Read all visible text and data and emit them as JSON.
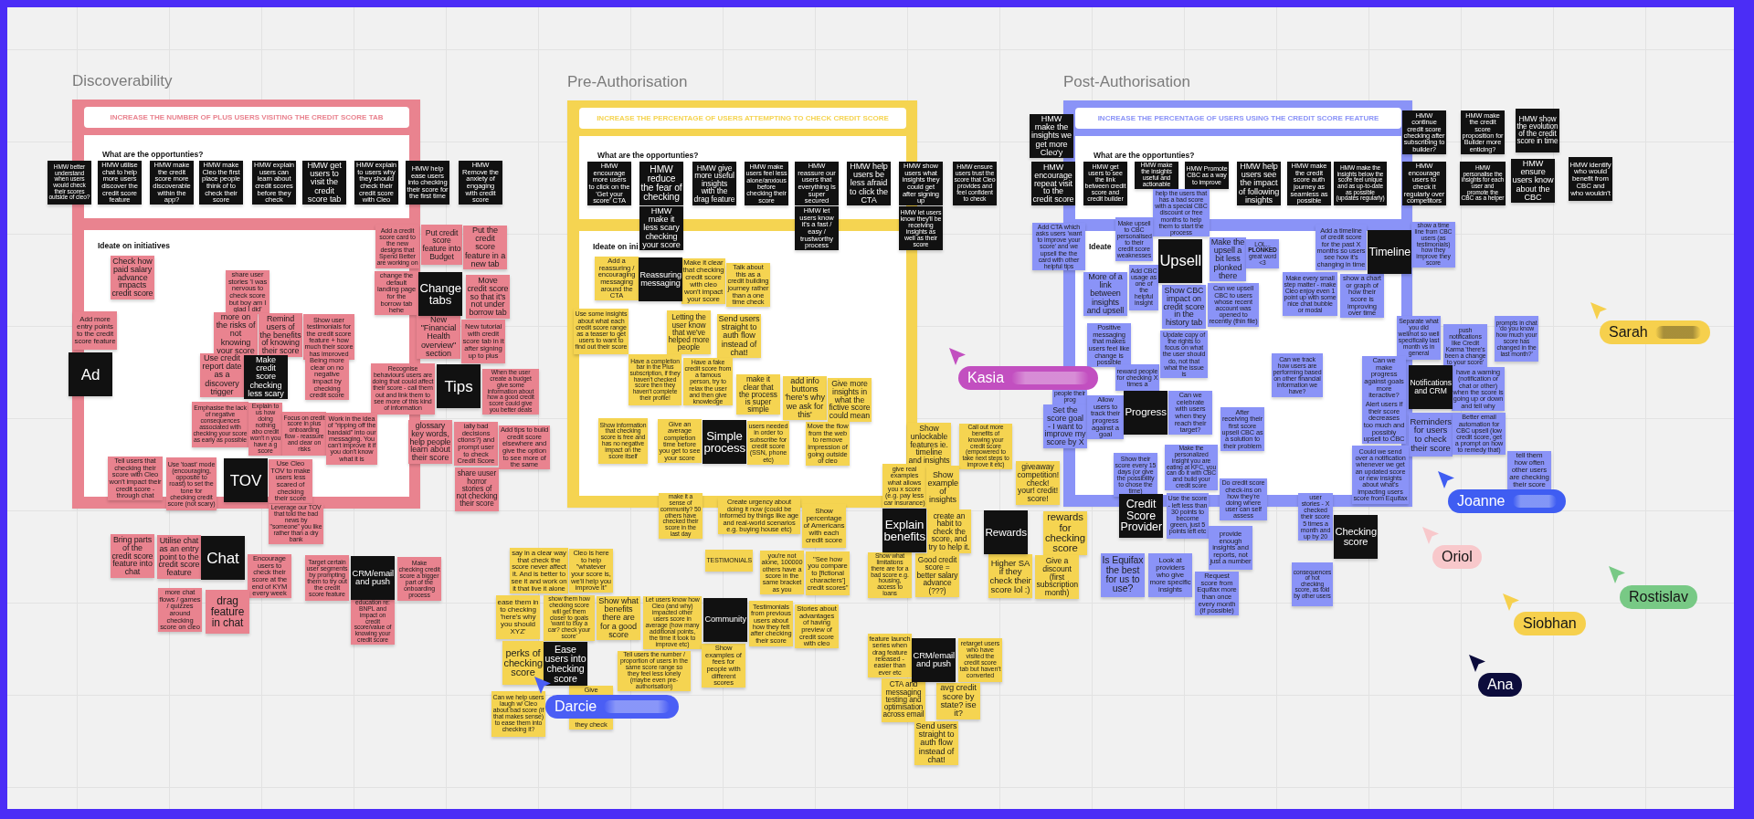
{
  "boards": [
    {
      "title": "Discoverability",
      "color": "#e9838f",
      "goal": "INCREASE THE NUMBER OF PLUS USERS VISITING THE CREDIT SCORE TAB",
      "opportunities_heading": "What are the opportunties?",
      "ideate_heading": "Ideate on initiatives",
      "opportunities": [
        "HMW better understand when users would check their scores outside of cleo?",
        "HMW utilise chat to help more users discover the credit score feature",
        "HMW make the credit score more discoverable within the app?",
        "HMW make Cleo the first place people think of to check their score",
        "HMW explain users can learn about credit scores before they check",
        "HMW get users to visit the credit score tab",
        "HMW explain to users why they should check their credit score with Cleo",
        "HMW help ease users into checking their score for the first time",
        "HMW Remove the anxiety of engaging with credit score"
      ],
      "notes": [
        {
          "kind": "idea",
          "text": "Add a credit score card to the new designs that Spend Better are working on"
        },
        {
          "kind": "idea",
          "text": "Put credit score feature into Budget"
        },
        {
          "kind": "idea",
          "text": "Put the credit score feature in a new tab"
        },
        {
          "kind": "idea",
          "text": "Check how paid salary advance impacts credit score"
        },
        {
          "kind": "idea",
          "text": "share user stories 'I was nervous to check score but boy am I glad I did'"
        },
        {
          "kind": "idea",
          "text": "change the default landing page for the borrow tab hehe"
        },
        {
          "kind": "theme",
          "text": "Change tabs"
        },
        {
          "kind": "idea",
          "text": "Move credit score so that it's not under borrow tab"
        },
        {
          "kind": "idea",
          "text": "Add more entry points to the credit score feature"
        },
        {
          "kind": "idea",
          "text": "more on the risks of not knowing your score"
        },
        {
          "kind": "idea",
          "text": "Remind users of the benefits of knowing their score"
        },
        {
          "kind": "idea",
          "text": "Show user testimonials for the credit score feature + how much their score has improved"
        },
        {
          "kind": "idea",
          "text": "New \"Financial Health overview\" section"
        },
        {
          "kind": "idea",
          "text": "New tutorial with credit score tab in it after signing up to plus"
        },
        {
          "kind": "theme",
          "text": "Ad"
        },
        {
          "kind": "idea",
          "text": "Use credit report date as a discovery trigger"
        },
        {
          "kind": "theme",
          "text": "Make credit score checking less scary"
        },
        {
          "kind": "idea",
          "text": "Being more clear on no negative impact by checking credit score"
        },
        {
          "kind": "idea",
          "text": "Recognise behaviours users are doing that could affect their score - call them out and link them to see more of this kind of information"
        },
        {
          "kind": "theme",
          "text": "Tips"
        },
        {
          "kind": "idea",
          "text": "When the user create a budget give some information about how a good credit score could give you better deals"
        },
        {
          "kind": "idea",
          "text": "Emphasise the lack of negative consequences associated with checking your score as early as possible"
        },
        {
          "kind": "idea",
          "text": "Explain to us how doing nothing abo credit won't n you have a g score"
        },
        {
          "kind": "idea",
          "text": "Focus on credit score in plus onboarding flow - reassure and clear on risks"
        },
        {
          "kind": "idea",
          "text": "Work in the idea of \"ripping off the bandaid\" into our messaging. You can't improve it if you don't know what it is"
        },
        {
          "kind": "idea",
          "text": "glossary key words, help people learn about their score"
        },
        {
          "kind": "idea",
          "text": "ially bad decisions ctions?) and prompt user to check Credit Score"
        },
        {
          "kind": "idea",
          "text": "Add tips to build credit score elsewhere and give the option to see more of the same"
        },
        {
          "kind": "idea",
          "text": "Tell users that checking their score with Cleo won't impact their credit score - through chat"
        },
        {
          "kind": "idea",
          "text": "Use 'toast' mode (encouraging, opposite to roast) to set the tone for checking credit score (not scary)"
        },
        {
          "kind": "theme",
          "text": "TOV"
        },
        {
          "kind": "idea",
          "text": "Use Cleo TOV to make users less scared of checking their score"
        },
        {
          "kind": "idea",
          "text": "share uuser horror stories of not checking their score"
        },
        {
          "kind": "idea",
          "text": "Leverage our TOV that told the bad news by \"someone\" you like rather than a dry bank"
        },
        {
          "kind": "idea",
          "text": "Bring parts of the credit score feature into chat"
        },
        {
          "kind": "idea",
          "text": "Utilise chat as an entry point to the credit score feature"
        },
        {
          "kind": "theme",
          "text": "Chat"
        },
        {
          "kind": "idea",
          "text": "Encourage users to check their score at the end of KYM every week"
        },
        {
          "kind": "idea",
          "text": "Target certain user segments by prompting them to try out the credit score feature"
        },
        {
          "kind": "theme",
          "text": "CRM/email and push"
        },
        {
          "kind": "idea",
          "text": "Make checking credit score a bigger part of the onboarding process"
        },
        {
          "kind": "idea",
          "text": "more chat flows / games / quizzes around checking score on cleo"
        },
        {
          "kind": "idea",
          "text": "drag feature in chat"
        },
        {
          "kind": "idea",
          "text": "education re: BNPL and impact on credit score/value of knowing your credit score"
        }
      ]
    },
    {
      "title": "Pre-Authorisation",
      "color": "#f5d451",
      "goal": "INCREASE THE PERCENTAGE OF USERS ATTEMPTING TO CHECK CREDIT SCORE",
      "opportunities_heading": "What are the opportunties?",
      "ideate_heading": "Ideate on ini",
      "opportunities": [
        "HMW encourage more users to click on the 'Get your score' CTA",
        "HMW reduce the fear of checking",
        "HMW give more useful insights with the drag feature",
        "HMW make users feel less alone/anxious before checking their score",
        "HMW reassure our users that everything is super secured",
        "HMW help users be less afraid to click the CTA",
        "HMW show users what insights they could get after signing up",
        "HMW ensure users trust the score that Cleo provides and feel confident to check",
        "HMW make it less scary checking your score",
        "HMW let users know it's a fast / easy / trustworthy process",
        "HMW let users know they'll be receiving insights as well as their score"
      ],
      "notes": [
        {
          "kind": "idea",
          "text": "Add a reassuring / encouraging messaging around the CTA"
        },
        {
          "kind": "theme",
          "text": "Reassuring messaging"
        },
        {
          "kind": "idea",
          "text": "Make it clear that checking credit score with cleo won't impact your score"
        },
        {
          "kind": "idea",
          "text": "Talk about this as a credit building journey rather than a one time check"
        },
        {
          "kind": "idea",
          "text": "Use some insights about what each credit score range as a teaser to get users to want to find out their score"
        },
        {
          "kind": "idea",
          "text": "Letting the user know that we've helped more people"
        },
        {
          "kind": "idea",
          "text": "Send users straight to auth flow instead of chat!"
        },
        {
          "kind": "idea",
          "text": "Have a completion bar in the Plus subscription, if they haven't checked score then they haven't complete their profile!"
        },
        {
          "kind": "idea",
          "text": "Have a fake credit score from a famous person, try to relax the user and then give knowledge"
        },
        {
          "kind": "idea",
          "text": "make it clear that the process is super simple"
        },
        {
          "kind": "idea",
          "text": "add info buttons 'here's why we ask for this'"
        },
        {
          "kind": "idea",
          "text": "Give more insights in what the fictive score could mean"
        },
        {
          "kind": "idea",
          "text": "Show information that checking score is free and has no negative impact on the score itself"
        },
        {
          "kind": "idea",
          "text": "Give an average completion time before you get to see your score"
        },
        {
          "kind": "theme",
          "text": "Simple process"
        },
        {
          "kind": "idea",
          "text": "users needed in order to subscribe for credit score (SSN, phone etc)"
        },
        {
          "kind": "idea",
          "text": "Move the flow from the web to remove impression of going outside of cleo"
        },
        {
          "kind": "idea",
          "text": "Show unlockable features ie. timeline and insights"
        },
        {
          "kind": "idea",
          "text": "Call out more benefits of knowing your credit score (empowered to take next steps to improve it etc)"
        },
        {
          "kind": "idea",
          "text": "give real examples what allows you x score (e.g. pay less car insurance)"
        },
        {
          "kind": "idea",
          "text": "Show example of insights"
        },
        {
          "kind": "idea",
          "text": "giveaway competition! check! your! credit! score!"
        },
        {
          "kind": "idea",
          "text": "make it a sense of community? 50 others have checked their score in the last day"
        },
        {
          "kind": "idea",
          "text": "Create urgency about doing it now (could be informed by things like age and real-world scenarios e.g. buying house etc)"
        },
        {
          "kind": "idea",
          "text": "Show percentage of Americans with each credit score"
        },
        {
          "kind": "theme",
          "text": "Explain benefits"
        },
        {
          "kind": "idea",
          "text": "create an habit to check the score, and try to help it."
        },
        {
          "kind": "theme",
          "text": "Rewards"
        },
        {
          "kind": "idea",
          "text": "rewards for checking score"
        },
        {
          "kind": "idea",
          "text": "say in a clear way that check the score never affect it. And is better to see it and work on it that live it alone"
        },
        {
          "kind": "idea",
          "text": "Cleo is here to help \"whatever your score is, we'll help you improve it\""
        },
        {
          "kind": "idea",
          "text": "TESTIMONIALS"
        },
        {
          "kind": "idea",
          "text": "you're not alone, 100000 others have a score in the same bracket as you"
        },
        {
          "kind": "idea",
          "text": "\"See how you compare to [fictional characters'] credit scores\""
        },
        {
          "kind": "idea",
          "text": "Show what limitations there are for a bad score e.g. housing, access to loans"
        },
        {
          "kind": "idea",
          "text": "Good credit score = better salary advance (???)"
        },
        {
          "kind": "idea",
          "text": "Higher SA if they check their score lol :)"
        },
        {
          "kind": "idea",
          "text": "Give a discount (first subscription month)"
        },
        {
          "kind": "idea",
          "text": "ease them in to checking 'here's why you should XYZ'"
        },
        {
          "kind": "idea",
          "text": "show them how checking score will get them closer to goals 'want to buy a car? check your score'"
        },
        {
          "kind": "idea",
          "text": "Show what benefits there are for a good score"
        },
        {
          "kind": "idea",
          "text": "Let users know how Cleo (and why) impacted other users score in average (how many additional points, the time it took to improve etc)"
        },
        {
          "kind": "theme",
          "text": "Community"
        },
        {
          "kind": "idea",
          "text": "Testimonials from previous users about how they felt after checking their score"
        },
        {
          "kind": "idea",
          "text": "Stories about advantages of having preview of credit score with cleo"
        },
        {
          "kind": "idea",
          "text": "perks of checking score"
        },
        {
          "kind": "theme",
          "text": "Ease users into checking score"
        },
        {
          "kind": "idea",
          "text": "Tell users the number / proportion of users in the same score range so they feel less lonely (maybe even pre-authorisation)"
        },
        {
          "kind": "idea",
          "text": "Show examples of fees for people with different scores"
        },
        {
          "kind": "idea",
          "text": "feature launch series when drag feature released - easier than ever etc"
        },
        {
          "kind": "theme",
          "text": "CRM/email and push"
        },
        {
          "kind": "idea",
          "text": "retarget users who have visited the credit score tab but haven't converted"
        },
        {
          "kind": "idea",
          "text": "Can we help users laugh w/ Cleo about bad score (if that makes sense) to ease them into checking it?"
        },
        {
          "kind": "idea",
          "text": "Give\n\n\n\n\nthey check"
        },
        {
          "kind": "idea",
          "text": "CTA and messaging testing and optimisation across email"
        },
        {
          "kind": "idea",
          "text": "avg credit score by state? ise it?"
        },
        {
          "kind": "idea",
          "text": "Send users straight to auth flow instead of chat!"
        }
      ]
    },
    {
      "title": "Post-Authorisation",
      "color": "#8a93f7",
      "goal": "INCREASE THE PERCENTAGE OF USERS USING THE CREDIT SCORE FEATURE",
      "opportunities_heading": "What are the opportunties?",
      "ideate_heading": "Ideate",
      "opportunities": [
        "HMW make the insights we get more Cleo'y",
        "HMW continue credit score checking after subscribing to builder?",
        "HMW make the credit score proposition for Builder more enticing?",
        "HMW show the evolution of the credit score in time",
        "HMW encourage repeat visit to the credit score",
        "HMW get users to see the link between credit score and credit builder",
        "HMW make the insights useful and actionable",
        "HMW Promote CBC as a way to improve",
        "HMW help users see the impact of following insights",
        "HMW make the credit score auth journey as seamless as possible",
        "HMW make the insights below the score feel unique and as up-to-date as possible (updates regularly)",
        "HMW encourage users to check it regularly over competitors",
        "HMW personalise the insights for each user and promote the CBC as a helper",
        "HMW ensure users know about the CBC",
        "HMW identify who would benefit from CBC and who wouldn't"
      ],
      "notes": [
        {
          "kind": "idea",
          "text": "help the users that has a bad score with a special CBC discount or free months to help them to start the process"
        },
        {
          "kind": "idea",
          "text": "Add CTA which asks users 'want to improve your score' and we upsell the the card with other helpful tips"
        },
        {
          "kind": "idea",
          "text": "Make upsell to CBC personalised to their credit score weaknesses"
        },
        {
          "kind": "theme",
          "text": "Upsell"
        },
        {
          "kind": "idea",
          "text": "Make the upsell a bit less plonked there"
        },
        {
          "kind": "idea",
          "text": "LOL... **PLONKED** great word <3"
        },
        {
          "kind": "idea",
          "text": "Add a timeline of credit score for the past X months so users see how it's changing in time"
        },
        {
          "kind": "theme",
          "text": "Timeline"
        },
        {
          "kind": "idea",
          "text": "show a time line from CBC users (as testimonials) how they improve they score"
        },
        {
          "kind": "idea",
          "text": "More of a link between insights and upsell"
        },
        {
          "kind": "idea",
          "text": "Add CBC usage as one of the helpful insight"
        },
        {
          "kind": "idea",
          "text": "Show CBC impact on credit score in the history tab"
        },
        {
          "kind": "idea",
          "text": "Can we upsell CBC to users whose recent account was opened to recently (thin file)"
        },
        {
          "kind": "idea",
          "text": "Make every small step matter - make Cleo enjoy even 1 point up with some nice chat bubble or modal"
        },
        {
          "kind": "idea",
          "text": "show a chart or graph of how their score is improving over time"
        },
        {
          "kind": "idea",
          "text": "Positive messaging that makes users feel like change is possible"
        },
        {
          "kind": "idea",
          "text": "Separate what you did well/not so well specifically last month vs in general"
        },
        {
          "kind": "idea",
          "text": "push notifications like Credit Karma 'there's been a change to your score'"
        },
        {
          "kind": "idea",
          "text": "prompts in chat 'do you know how much your score has changed in the last month?'"
        },
        {
          "kind": "idea",
          "text": "reward people for checking X times a"
        },
        {
          "kind": "idea",
          "text": "people their prog"
        },
        {
          "kind": "idea",
          "text": "Update copy of the rights to focus on what the user should do, not that what the issue is"
        },
        {
          "kind": "idea",
          "text": "Can we track how users are performing based on other financial information we have?"
        },
        {
          "kind": "idea",
          "text": "Can we make progress against goals more iteractive?"
        },
        {
          "kind": "theme",
          "text": "Notifications and CRM"
        },
        {
          "kind": "idea",
          "text": "have a warning (notification or chat or other) when the score is going up or down and tell why"
        },
        {
          "kind": "idea",
          "text": "Set the score goal - I want to improve my score by X"
        },
        {
          "kind": "idea",
          "text": "Allow users to track their progress against a goal"
        },
        {
          "kind": "theme",
          "text": "Progress"
        },
        {
          "kind": "idea",
          "text": "Can we celebrate with users when they reach their target?"
        },
        {
          "kind": "idea",
          "text": "After receiving their first score upsell CBC as a solution to their problem"
        },
        {
          "kind": "idea",
          "text": "Alert users if their score decreases too much and possibly upsell to CBC"
        },
        {
          "kind": "idea",
          "text": "Reminders for users to check their score"
        },
        {
          "kind": "idea",
          "text": "Better email automation for CBC upsell (low credit score, get a prompt on how to remedy that)"
        },
        {
          "kind": "idea",
          "text": "Show their score every 15 days (or give the possibility to chose the time)"
        },
        {
          "kind": "idea",
          "text": "Make the personalized insight you are eating at KFC, you can do it with CBC and build your credit score"
        },
        {
          "kind": "idea",
          "text": "Could we send over a notification whenever we get an updated score or new insights about what's impacting users score from Equifax"
        },
        {
          "kind": "idea",
          "text": "tell them how often other users are checking their score"
        },
        {
          "kind": "theme",
          "text": "Credit Score Provider"
        },
        {
          "kind": "idea",
          "text": "Use the score - left less than 30 points to become green, just 5 points left etc"
        },
        {
          "kind": "idea",
          "text": "Do credit score check-ins on how they're doing where user can self assess"
        },
        {
          "kind": "idea",
          "text": "user stories - X checked their score 5 times a month and up by 20"
        },
        {
          "kind": "idea",
          "text": "provide enough insights and reports, not just a number"
        },
        {
          "kind": "theme",
          "text": "Checking score"
        },
        {
          "kind": "idea",
          "text": "Is Equifax the best for us to use?"
        },
        {
          "kind": "idea",
          "text": "Look at providers who give more specific insights"
        },
        {
          "kind": "idea",
          "text": "Request score from Equifax more than once every month (if possible)"
        },
        {
          "kind": "idea",
          "text": "consequences of not checking score, as told by other users"
        }
      ]
    }
  ],
  "collaborators": [
    {
      "name": "Sarah",
      "color": "#f6d04d",
      "redacted": true
    },
    {
      "name": "Kasia",
      "color": "#c24fc0",
      "redacted": true
    },
    {
      "name": "Joanne",
      "color": "#3f5df2",
      "redacted": true
    },
    {
      "name": "Oriol",
      "color": "#f8c8cb",
      "redacted": false
    },
    {
      "name": "Rostislav",
      "color": "#78c985",
      "redacted": false
    },
    {
      "name": "Siobhan",
      "color": "#f6d04d",
      "redacted": false
    },
    {
      "name": "Ana",
      "color": "#0c0c3c",
      "redacted": false
    },
    {
      "name": "Darcie",
      "color": "#4a5ef5",
      "redacted": true
    }
  ]
}
